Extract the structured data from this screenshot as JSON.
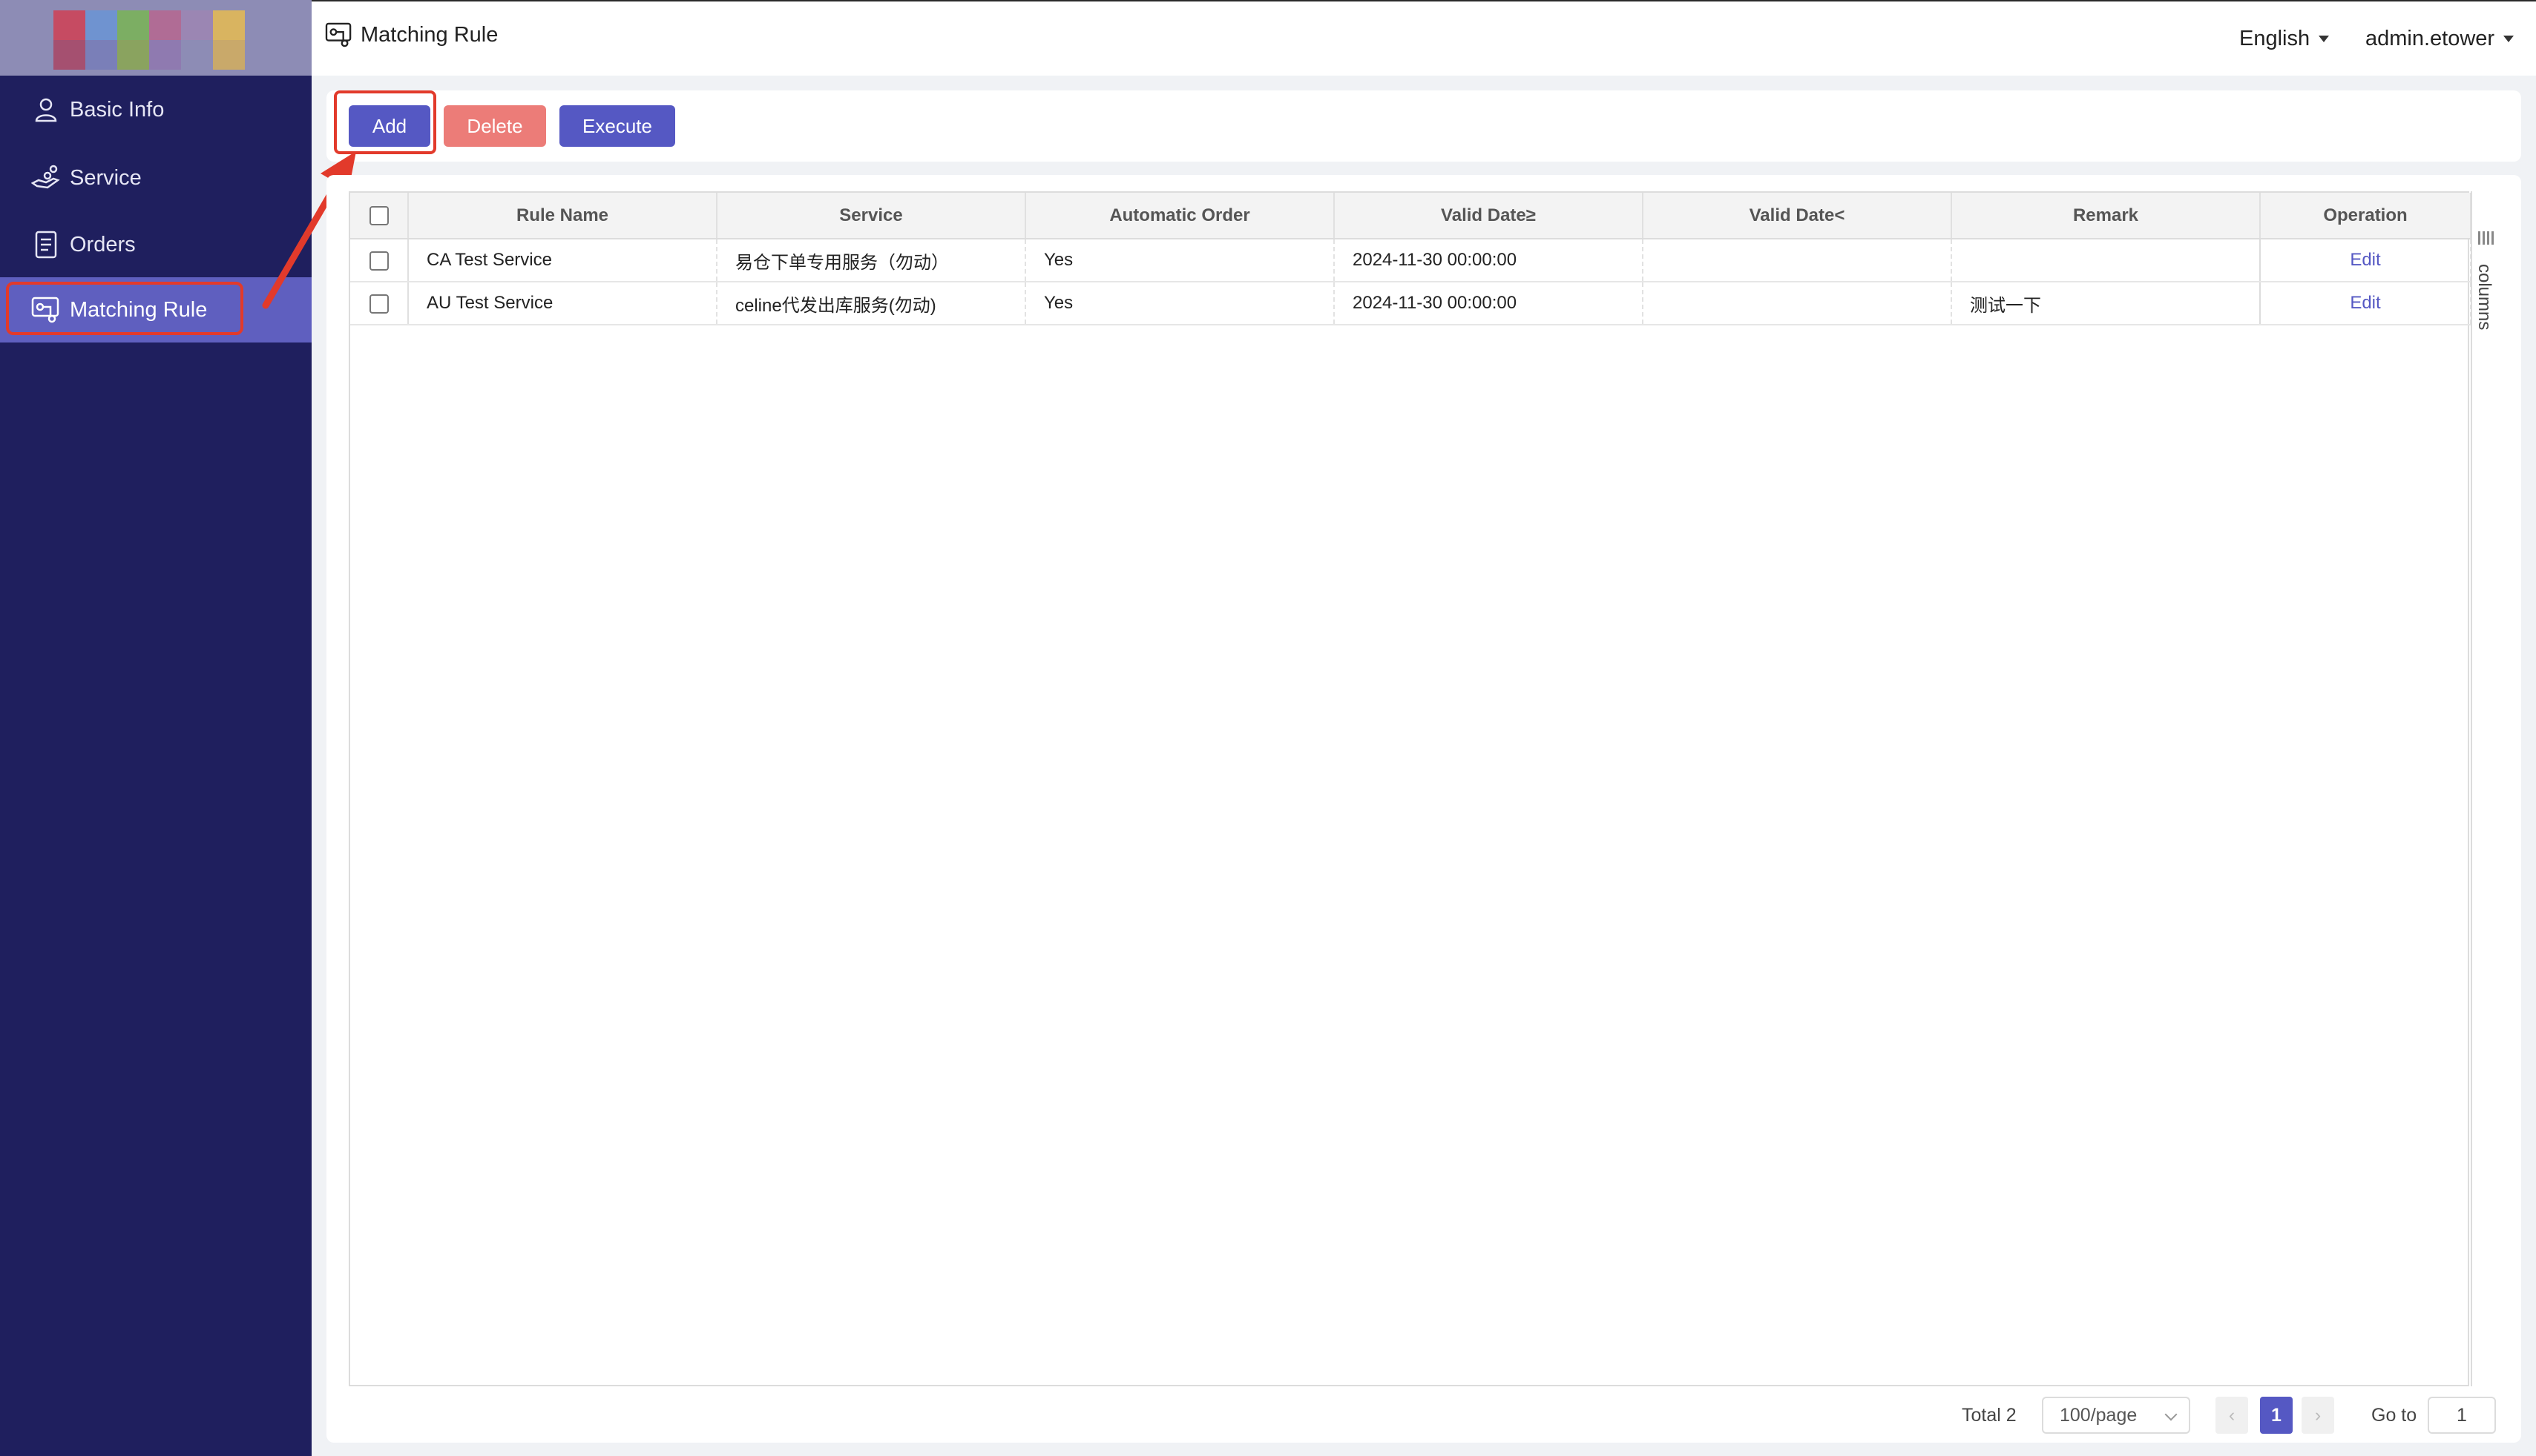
{
  "sidebar": {
    "items": [
      {
        "label": "Basic Info",
        "icon": "user-icon"
      },
      {
        "label": "Service",
        "icon": "service-icon"
      },
      {
        "label": "Orders",
        "icon": "orders-icon"
      },
      {
        "label": "Matching Rule",
        "icon": "matching-rule-icon",
        "active": true
      }
    ]
  },
  "header": {
    "title": "Matching Rule",
    "language": "English",
    "user": "admin.etower"
  },
  "toolbar": {
    "add_label": "Add",
    "delete_label": "Delete",
    "execute_label": "Execute"
  },
  "table": {
    "columns": [
      "Rule Name",
      "Service",
      "Automatic Order",
      "Valid Date≥",
      "Valid Date<",
      "Remark",
      "Operation"
    ],
    "rows": [
      {
        "rule_name": "CA Test Service",
        "service": "易仓下单专用服务（勿动）",
        "automatic_order": "Yes",
        "valid_from": "2024-11-30 00:00:00",
        "valid_to": "",
        "remark": "",
        "operation": "Edit"
      },
      {
        "rule_name": "AU Test Service",
        "service": "celine代发出库服务(勿动)",
        "automatic_order": "Yes",
        "valid_from": "2024-11-30 00:00:00",
        "valid_to": "",
        "remark": "测试一下",
        "operation": "Edit"
      }
    ],
    "columns_toggle_label": "columns"
  },
  "pagination": {
    "total_label": "Total 2",
    "page_size": "100/page",
    "current_page": "1",
    "prev": "‹",
    "next": "›",
    "goto_label": "Go to",
    "goto_value": "1"
  },
  "colors": {
    "sidebar_bg": "#1f1f5e",
    "sidebar_active": "#5f5fbf",
    "primary": "#5558c3",
    "danger": "#ec7c78",
    "annotation": "#e23a2b"
  }
}
